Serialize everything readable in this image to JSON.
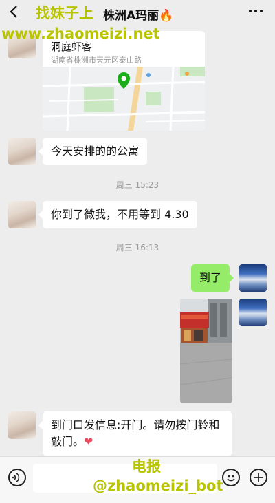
{
  "header": {
    "back_icon": "chevron-left-icon",
    "title": "株洲A玛丽🔥",
    "more_icon": "more-dots-icon"
  },
  "watermark": {
    "line1": "找妹子上",
    "line2": "www.zhaomeizi.net",
    "line3": "电报",
    "line4": "@zhaomeizi_bot"
  },
  "messages": {
    "location": {
      "name": "洞庭虾客",
      "address": "湖南省株洲市天元区泰山路"
    },
    "msg1": "今天安排的的公寓",
    "time1": "周三 15:23",
    "msg2": "你到了微我，不用等到 4.30",
    "time2": "周三 16:13",
    "msg3": "到了",
    "msg4": "到门口发信息:开门。请勿按门铃和敲门。",
    "heart": "❤"
  },
  "input_bar": {
    "voice_icon": "voice-icon",
    "emoji_icon": "emoji-icon",
    "plus_icon": "plus-icon",
    "placeholder": ""
  },
  "colors": {
    "background": "#ededed",
    "green_bubble": "#95ec69",
    "watermark": "#b8c400"
  }
}
